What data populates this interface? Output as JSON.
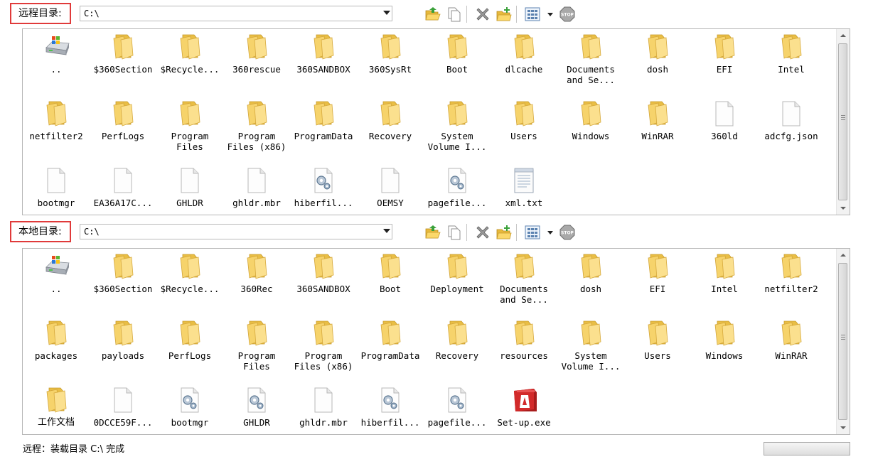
{
  "remote": {
    "label": "远程目录:",
    "path": "C:\\",
    "items": [
      {
        "name": "..",
        "icon": "drive-up-icon"
      },
      {
        "name": "$360Section",
        "icon": "folder-icon"
      },
      {
        "name": "$Recycle...",
        "icon": "folder-icon"
      },
      {
        "name": "360rescue",
        "icon": "folder-icon"
      },
      {
        "name": "360SANDBOX",
        "icon": "folder-icon"
      },
      {
        "name": "360SysRt",
        "icon": "folder-icon"
      },
      {
        "name": "Boot",
        "icon": "folder-icon"
      },
      {
        "name": "dlcache",
        "icon": "folder-icon"
      },
      {
        "name": "Documents\nand Se...",
        "icon": "folder-icon"
      },
      {
        "name": "dosh",
        "icon": "folder-icon"
      },
      {
        "name": "EFI",
        "icon": "folder-icon"
      },
      {
        "name": "Intel",
        "icon": "folder-icon"
      },
      {
        "name": "netfilter2",
        "icon": "folder-icon"
      },
      {
        "name": "PerfLogs",
        "icon": "folder-icon"
      },
      {
        "name": "Program\nFiles",
        "icon": "folder-icon"
      },
      {
        "name": "Program\nFiles (x86)",
        "icon": "folder-icon"
      },
      {
        "name": "ProgramData",
        "icon": "folder-icon"
      },
      {
        "name": "Recovery",
        "icon": "folder-icon"
      },
      {
        "name": "System\nVolume I...",
        "icon": "folder-icon"
      },
      {
        "name": "Users",
        "icon": "folder-icon"
      },
      {
        "name": "Windows",
        "icon": "folder-icon"
      },
      {
        "name": "WinRAR",
        "icon": "folder-icon"
      },
      {
        "name": "360ld",
        "icon": "file-icon"
      },
      {
        "name": "adcfg.json",
        "icon": "file-icon"
      },
      {
        "name": "bootmgr",
        "icon": "file-icon"
      },
      {
        "name": "EA36A17C...",
        "icon": "file-icon"
      },
      {
        "name": "GHLDR",
        "icon": "file-icon"
      },
      {
        "name": "ghldr.mbr",
        "icon": "file-icon"
      },
      {
        "name": "hiberfil...",
        "icon": "system-file-icon"
      },
      {
        "name": "OEMSY",
        "icon": "file-icon"
      },
      {
        "name": "pagefile...",
        "icon": "system-file-icon"
      },
      {
        "name": "xml.txt",
        "icon": "text-file-icon"
      }
    ]
  },
  "local": {
    "label": "本地目录:",
    "path": "C:\\",
    "items": [
      {
        "name": "..",
        "icon": "drive-up-icon"
      },
      {
        "name": "$360Section",
        "icon": "folder-icon"
      },
      {
        "name": "$Recycle...",
        "icon": "folder-icon"
      },
      {
        "name": "360Rec",
        "icon": "folder-icon"
      },
      {
        "name": "360SANDBOX",
        "icon": "folder-icon"
      },
      {
        "name": "Boot",
        "icon": "folder-icon"
      },
      {
        "name": "Deployment",
        "icon": "folder-icon"
      },
      {
        "name": "Documents\nand Se...",
        "icon": "folder-icon"
      },
      {
        "name": "dosh",
        "icon": "folder-icon"
      },
      {
        "name": "EFI",
        "icon": "folder-icon"
      },
      {
        "name": "Intel",
        "icon": "folder-icon"
      },
      {
        "name": "netfilter2",
        "icon": "folder-icon"
      },
      {
        "name": "packages",
        "icon": "folder-icon"
      },
      {
        "name": "payloads",
        "icon": "folder-icon"
      },
      {
        "name": "PerfLogs",
        "icon": "folder-icon"
      },
      {
        "name": "Program\nFiles",
        "icon": "folder-icon"
      },
      {
        "name": "Program\nFiles (x86)",
        "icon": "folder-icon"
      },
      {
        "name": "ProgramData",
        "icon": "folder-icon"
      },
      {
        "name": "Recovery",
        "icon": "folder-icon"
      },
      {
        "name": "resources",
        "icon": "folder-icon"
      },
      {
        "name": "System\nVolume I...",
        "icon": "folder-icon"
      },
      {
        "name": "Users",
        "icon": "folder-icon"
      },
      {
        "name": "Windows",
        "icon": "folder-icon"
      },
      {
        "name": "WinRAR",
        "icon": "folder-icon"
      },
      {
        "name": "工作文档",
        "icon": "folder-icon"
      },
      {
        "name": "0DCCE59F...",
        "icon": "file-icon"
      },
      {
        "name": "bootmgr",
        "icon": "system-file-icon"
      },
      {
        "name": "GHLDR",
        "icon": "system-file-icon"
      },
      {
        "name": "ghldr.mbr",
        "icon": "file-icon"
      },
      {
        "name": "hiberfil...",
        "icon": "system-file-icon"
      },
      {
        "name": "pagefile...",
        "icon": "system-file-icon"
      },
      {
        "name": "Set-up.exe",
        "icon": "installer-exe-icon"
      }
    ]
  },
  "toolbar": {
    "icons": [
      "open-folder-icon",
      "copy-icon",
      "delete-icon",
      "new-folder-icon",
      "view-mode-icon",
      "stop-icon"
    ],
    "stop_text": "STOP"
  },
  "status": {
    "text": "远程：装载目录 C:\\ 完成"
  },
  "colors": {
    "highlight_border": "#e03a3a",
    "folder": "#f6d36b"
  }
}
